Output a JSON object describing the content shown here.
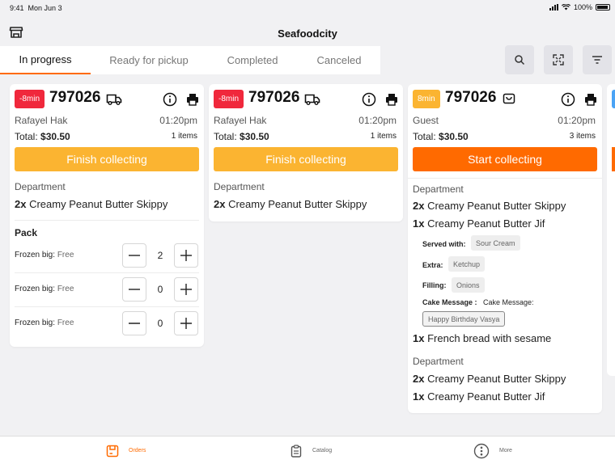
{
  "status_bar": {
    "time": "9:41",
    "date": "Mon Jun 3",
    "battery": "100%"
  },
  "header": {
    "title": "Seafoodcity"
  },
  "tabs": [
    {
      "label": "In progress",
      "active": true
    },
    {
      "label": "Ready for pickup",
      "active": false
    },
    {
      "label": "Completed",
      "active": false
    },
    {
      "label": "Canceled",
      "active": false
    }
  ],
  "toolbar": {
    "icons": [
      "search-icon",
      "expand-icon",
      "filter-icon"
    ]
  },
  "orders": [
    {
      "badge": "-8min",
      "badge_color": "#f0283c",
      "number": "797026",
      "type_icon": "truck-icon",
      "customer": "Rafayel Hak",
      "time": "01:20pm",
      "total_label": "Total:",
      "total": "$30.50",
      "items": "1 items",
      "action": "Finish collecting",
      "action_color": "#fbb431",
      "department": "Department",
      "lines": [
        {
          "qty": "2x",
          "name": "Creamy Peanut Butter Skippy"
        }
      ],
      "pack": {
        "title": "Pack",
        "rows": [
          {
            "label": "Frozen big:",
            "price": "Free",
            "qty": "2"
          },
          {
            "label": "Frozen big:",
            "price": "Free",
            "qty": "0"
          },
          {
            "label": "Frozen big:",
            "price": "Free",
            "qty": "0"
          }
        ]
      }
    },
    {
      "badge": "-8min",
      "badge_color": "#f0283c",
      "number": "797026",
      "type_icon": "truck-icon",
      "customer": "Rafayel Hak",
      "time": "01:20pm",
      "total_label": "Total:",
      "total": "$30.50",
      "items": "1 items",
      "action": "Finish collecting",
      "action_color": "#fbb431",
      "department": "Department",
      "lines": [
        {
          "qty": "2x",
          "name": "Creamy Peanut Butter Skippy"
        }
      ]
    },
    {
      "badge": "8min",
      "badge_color": "#fbb431",
      "number": "797026",
      "type_icon": "bag-icon",
      "customer": "Guest",
      "time": "01:20pm",
      "total_label": "Total:",
      "total": "$30.50",
      "items": "3 items",
      "action": "Start collecting",
      "action_color": "#ff6a00",
      "department": "Department",
      "lines": [
        {
          "qty": "2x",
          "name": "Creamy Peanut Butter Skippy"
        },
        {
          "qty": "1x",
          "name": "Creamy Peanut Butter Jif"
        }
      ],
      "modifiers": {
        "served_label": "Served with:",
        "served_value": "Sour Cream",
        "extra_label": "Extra:",
        "extra_value": "Ketchup",
        "filling_label": "Filling:",
        "filling_value": "Onions",
        "cake_label": "Cake Message :",
        "cake_text": "Cake Message:",
        "cake_value": "Happy Birthday Vasya"
      },
      "line3": {
        "qty": "1x",
        "name": "French bread with sesame"
      },
      "department2": "Department",
      "lines2": [
        {
          "qty": "2x",
          "name": "Creamy Peanut Butter Skippy"
        },
        {
          "qty": "1x",
          "name": "Creamy Peanut Butter Jif"
        }
      ]
    }
  ],
  "bottom_nav": [
    {
      "label": "Orders",
      "icon": "orders-icon",
      "active": true
    },
    {
      "label": "Catalog",
      "icon": "clipboard-icon",
      "active": false
    },
    {
      "label": "More",
      "icon": "more-icon",
      "active": false
    }
  ],
  "colors": {
    "accent": "#ff6a00",
    "warning": "#fbb431",
    "danger": "#f0283c",
    "info": "#4aa3f5"
  }
}
